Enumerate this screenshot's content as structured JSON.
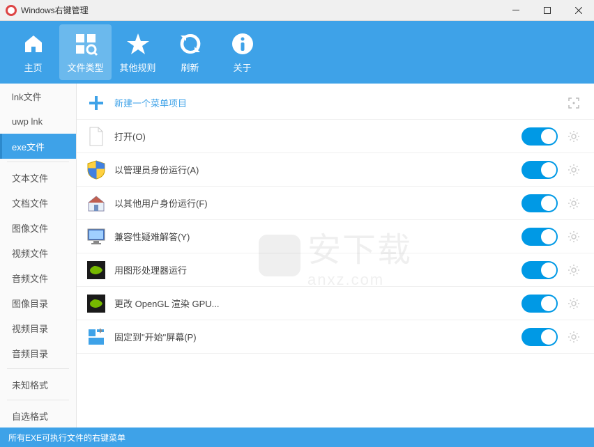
{
  "window": {
    "title": "Windows右键管理"
  },
  "toolbar": {
    "home": "主页",
    "filetype": "文件类型",
    "other": "其他规则",
    "refresh": "刷新",
    "about": "关于"
  },
  "sidebar": {
    "items": [
      {
        "label": "lnk文件"
      },
      {
        "label": "uwp lnk"
      },
      {
        "label": "exe文件",
        "active": true
      },
      {
        "divider": true
      },
      {
        "label": "文本文件"
      },
      {
        "label": "文档文件"
      },
      {
        "label": "图像文件"
      },
      {
        "label": "视频文件"
      },
      {
        "label": "音频文件"
      },
      {
        "label": "图像目录"
      },
      {
        "label": "视频目录"
      },
      {
        "label": "音频目录"
      },
      {
        "divider": true
      },
      {
        "label": "未知格式"
      },
      {
        "divider": true
      },
      {
        "label": "自选格式"
      }
    ]
  },
  "content": {
    "new_label": "新建一个菜单项目",
    "rows": [
      {
        "label": "打开(O)",
        "icon": "file"
      },
      {
        "label": "以管理员身份运行(A)",
        "icon": "shield"
      },
      {
        "label": "以其他用户身份运行(F)",
        "icon": "house"
      },
      {
        "label": "兼容性疑难解答(Y)",
        "icon": "monitor"
      },
      {
        "label": "用图形处理器运行",
        "icon": "nvidia"
      },
      {
        "label": "更改 OpenGL 渲染 GPU...",
        "icon": "nvidia"
      },
      {
        "label": "固定到\"开始\"屏幕(P)",
        "icon": "tiles"
      }
    ]
  },
  "statusbar": {
    "text": "所有EXE可执行文件的右键菜单"
  },
  "watermark": {
    "text": "安下载",
    "sub": "anxz.com"
  }
}
